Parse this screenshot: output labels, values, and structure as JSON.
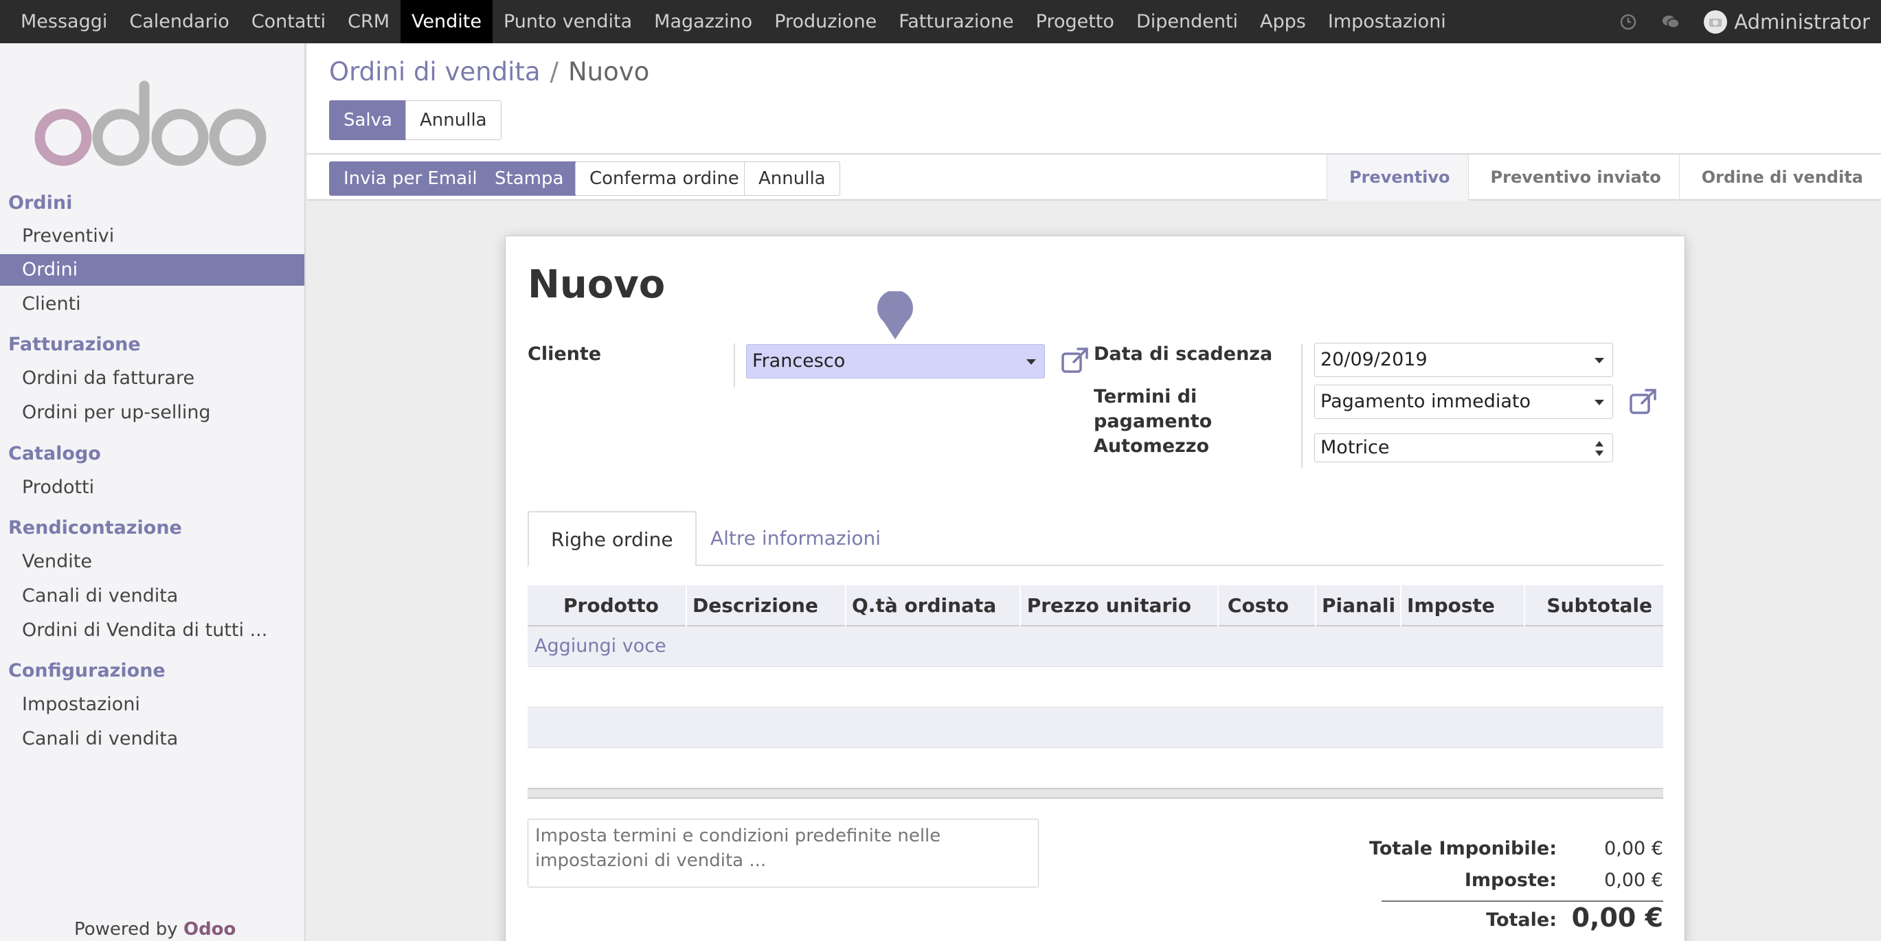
{
  "topbar": {
    "menus": [
      "Messaggi",
      "Calendario",
      "Contatti",
      "CRM",
      "Vendite",
      "Punto vendita",
      "Magazzino",
      "Produzione",
      "Fatturazione",
      "Progetto",
      "Dipendenti",
      "Apps",
      "Impostazioni"
    ],
    "active_menu": "Vendite",
    "user": "Administrator",
    "icons": [
      "clock-icon",
      "chat-icon"
    ]
  },
  "sidebar": {
    "logo": "odoo",
    "sections": [
      {
        "title": "Ordini",
        "items": [
          "Preventivi",
          "Ordini",
          "Clienti"
        ]
      },
      {
        "title": "Fatturazione",
        "items": [
          "Ordini da fatturare",
          "Ordini per up-selling"
        ]
      },
      {
        "title": "Catalogo",
        "items": [
          "Prodotti"
        ]
      },
      {
        "title": "Rendicontazione",
        "items": [
          "Vendite",
          "Canali di vendita",
          "Ordini di Vendita di tutti ..."
        ]
      },
      {
        "title": "Configurazione",
        "items": [
          "Impostazioni",
          "Canali di vendita"
        ]
      }
    ],
    "active_item": "Ordini",
    "powered_prefix": "Powered by",
    "powered_brand": "Odoo"
  },
  "control_panel": {
    "breadcrumb_parent": "Ordini di vendita",
    "breadcrumb_sep": "/",
    "breadcrumb_current": "Nuovo",
    "save_label": "Salva",
    "discard_label": "Annulla"
  },
  "statusbar": {
    "buttons": [
      "Invia per Email",
      "Stampa",
      "Conferma ordine",
      "Annulla"
    ],
    "stages": [
      "Preventivo",
      "Preventivo inviato",
      "Ordine di vendita"
    ],
    "current_stage": "Preventivo"
  },
  "form": {
    "title": "Nuovo",
    "cliente_label": "Cliente",
    "cliente_value": "Francesco",
    "data_label": "Data di scadenza",
    "data_value": "20/09/2019",
    "termini_label": "Termini di pagamento",
    "termini_value": "Pagamento immediato",
    "automezzo_label": "Automezzo",
    "automezzo_value": "Motrice",
    "tabs": [
      "Righe ordine",
      "Altre informazioni"
    ],
    "columns": [
      "Prodotto",
      "Descrizione",
      "Q.tà ordinata",
      "Prezzo unitario",
      "Costo",
      "Pianali",
      "Imposte",
      "Subtotale"
    ],
    "add_line": "Aggiungi voce",
    "note_placeholder": "Imposta termini e condizioni predefinite nelle impostazioni di vendita ...",
    "totals": {
      "imponibile_label": "Totale Imponibile:",
      "imponibile_value": "0,00 €",
      "imposte_label": "Imposte:",
      "imposte_value": "0,00 €",
      "totale_label": "Totale:",
      "totale_value": "0,00 €"
    }
  },
  "colors": {
    "brand": "#7c7bad",
    "topbar": "#2c2c2c",
    "cliente_highlight": "#d4d4fb"
  }
}
